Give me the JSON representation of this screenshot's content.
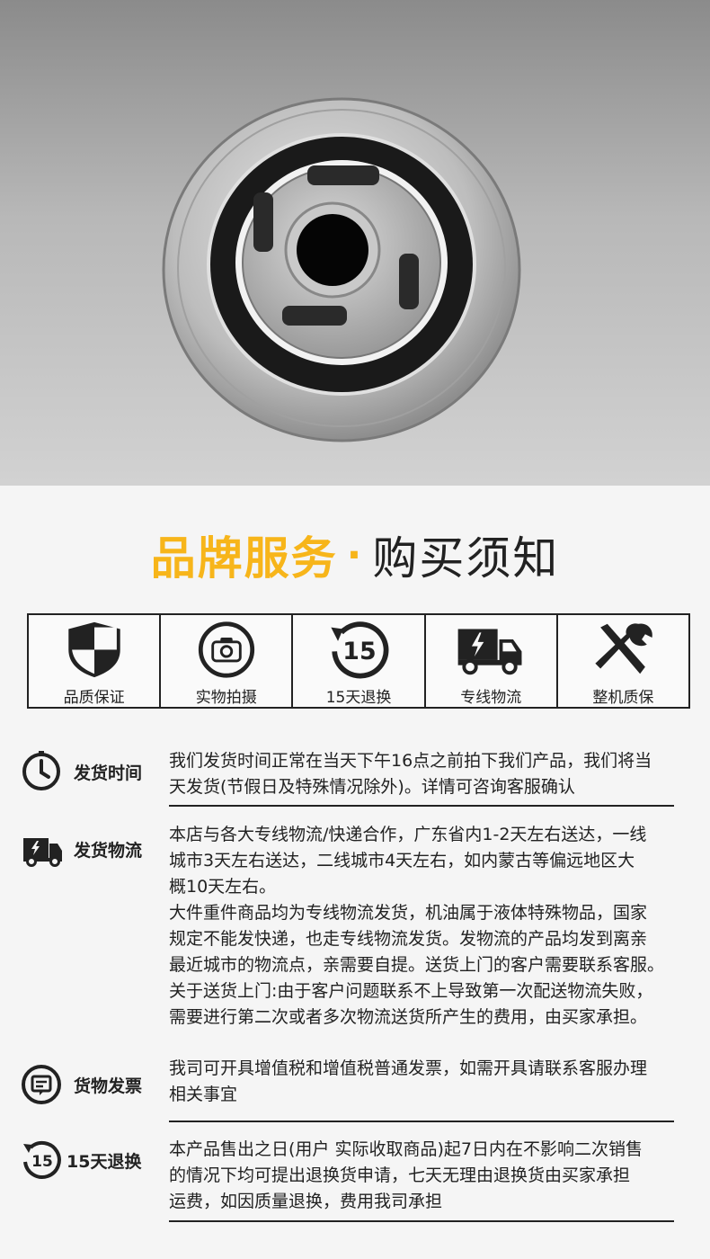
{
  "title": {
    "highlight": "品牌服务",
    "separator": "·",
    "normal": "购买须知"
  },
  "services": [
    {
      "icon": "shield-icon",
      "label": "品质保证"
    },
    {
      "icon": "camera-icon",
      "label": "实物拍摄"
    },
    {
      "icon": "15-day-return-icon",
      "label": "15天退换"
    },
    {
      "icon": "truck-icon",
      "label": "专线物流"
    },
    {
      "icon": "tools-icon",
      "label": "整机质保"
    }
  ],
  "info": {
    "shipping_time": {
      "icon": "clock-icon",
      "label": "发货时间",
      "lines": [
        "我们发货时间正常在当天下午16点之前拍下我们产品，我们将当",
        "天发货(节假日及特殊情况除外)。详情可咨询客服确认"
      ]
    },
    "logistics": {
      "icon": "truck-icon",
      "label": "发货物流",
      "lines": [
        "本店与各大专线物流/快递合作，广东省内1-2天左右送达，一线",
        "城市3天左右送达，二线城市4天左右，如内蒙古等偏远地区大",
        "概10天左右。",
        "大件重件商品均为专线物流发货，机油属于液体特殊物品，国家",
        "规定不能发快递，也走专线物流发货。发物流的产品均发到离亲",
        "最近城市的物流点，亲需要自提。送货上门的客户需要联系客服。",
        "关于送货上门:由于客户问题联系不上导致第一次配送物流失败，",
        "需要进行第二次或者多次物流送货所产生的费用，由买家承担。"
      ]
    },
    "invoice": {
      "icon": "invoice-icon",
      "label": "货物发票",
      "lines": [
        "我司可开具增值税和增值税普通发票，如需开具请联系客服办理",
        "相关事宜"
      ]
    },
    "returns": {
      "icon": "15-day-return-icon",
      "label": "15天退换",
      "lines": [
        "本产品售出之日(用户 实际收取商品)起7日内在不影响二次销售",
        "的情况下均可提出退换货申请，七天无理由退换货由买家承担",
        "运费，如因质量退换，费用我司承担"
      ]
    }
  },
  "colors": {
    "accent": "#f7b51a",
    "ink": "#222222"
  }
}
